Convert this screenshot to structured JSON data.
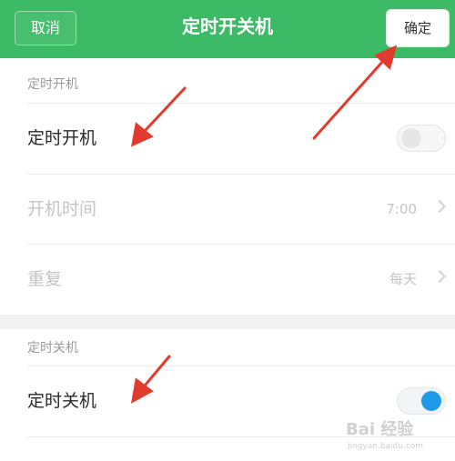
{
  "header": {
    "cancel_label": "取消",
    "title": "定时开关机",
    "confirm_label": "确定"
  },
  "power_on": {
    "section_label": "定时开机",
    "toggle_label": "定时开机",
    "toggle_state": "off",
    "time_label": "开机时间",
    "time_value": "7:00",
    "repeat_label": "重复",
    "repeat_value": "每天"
  },
  "power_off": {
    "section_label": "定时关机",
    "toggle_label": "定时关机",
    "toggle_state": "on"
  },
  "watermark": {
    "main": "Bai 经验",
    "sub": "jingyan.baidu.com"
  },
  "colors": {
    "header_bg": "#3dba66",
    "annotation_arrow": "#e23b2e",
    "toggle_on": "#1e9be8"
  }
}
